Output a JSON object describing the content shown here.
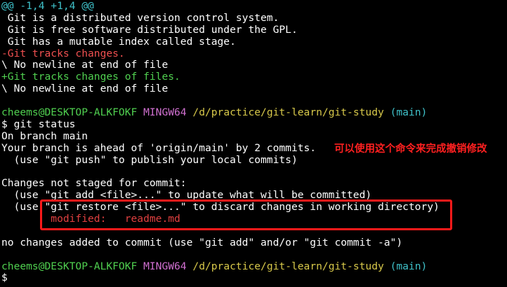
{
  "diff": {
    "hunk_header": "@@ -1,4 +1,4 @@",
    "context_1": " Git is a distributed version control system.",
    "context_2": " Git is free software distributed under the GPL.",
    "context_3": " Git has a mutable index called stage.",
    "removed": "-Git tracks changes.",
    "no_newline_1": "\\ No newline at end of file",
    "added": "+Git tracks changes of files.",
    "no_newline_2": "\\ No newline at end of file"
  },
  "prompt1": {
    "user_host": "cheems@DESKTOP-ALKFOKF",
    "env": "MINGW64",
    "path": "/d/practice/git-learn/git-study",
    "branch": "(main)"
  },
  "command": "$ git status",
  "status": {
    "on_branch": "On branch main",
    "ahead": "Your branch is ahead of 'origin/main' by 2 commits.",
    "push_hint": "  (use \"git push\" to publish your local commits)",
    "changes_header": "Changes not staged for commit:",
    "add_hint": "  (use \"git add <file>...\" to update what will be committed)",
    "restore_hint": "  (use \"git restore <file>...\" to discard changes in working directory)",
    "modified_line": "        modified:   readme.md",
    "no_changes": "no changes added to commit (use \"git add\" and/or \"git commit -a\")"
  },
  "prompt2": {
    "user_host": "cheems@DESKTOP-ALKFOKF",
    "env": "MINGW64",
    "path": "/d/practice/git-learn/git-study",
    "branch": "(main)"
  },
  "final_prompt": "$",
  "annotation": "可以使用这个命令来完成撤销修改",
  "colors": {
    "background": "#000000",
    "cyan": "#3fc1c9",
    "removed_red": "#f05050",
    "added_green": "#50d050",
    "magenta": "#d070d0",
    "yellow": "#d7c84a",
    "annotation_red": "#ff2020"
  }
}
